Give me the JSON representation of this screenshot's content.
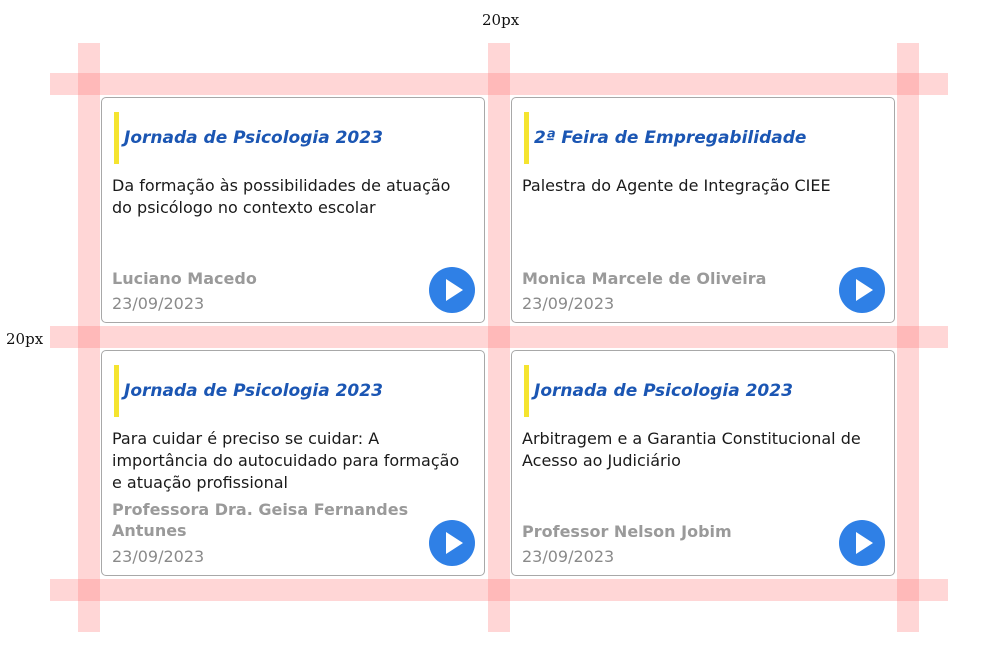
{
  "guides": {
    "top_label": "20px",
    "left_label": "20px"
  },
  "cards": [
    {
      "title": "Jornada de Psicologia 2023",
      "text": "Da formação às possibilidades de atuação do psicólogo no contexto escolar",
      "author": "Luciano Macedo",
      "date": "23/09/2023"
    },
    {
      "title": "2ª Feira de Empregabilidade",
      "text": "Palestra do Agente de Integração CIEE",
      "author": "Monica Marcele de Oliveira",
      "date": "23/09/2023"
    },
    {
      "title": "Jornada de Psicologia 2023",
      "text": "Para cuidar é preciso se cuidar: A importância do autocuidado para formação e atuação profissional",
      "author": "Professora Dra. Geisa Fernandes Antunes",
      "date": "23/09/2023"
    },
    {
      "title": "Jornada de Psicologia 2023",
      "text": "Arbitragem e a Garantia Constitucional de Acesso ao Judiciário",
      "author": "Professor Nelson Jobim",
      "date": "23/09/2023"
    }
  ],
  "colors": {
    "title": "#1b56b3",
    "accent_bar": "#f5e42f",
    "play_button": "#2f80e6",
    "guide": "#ff7878"
  },
  "icons": {
    "play": "play-icon"
  }
}
